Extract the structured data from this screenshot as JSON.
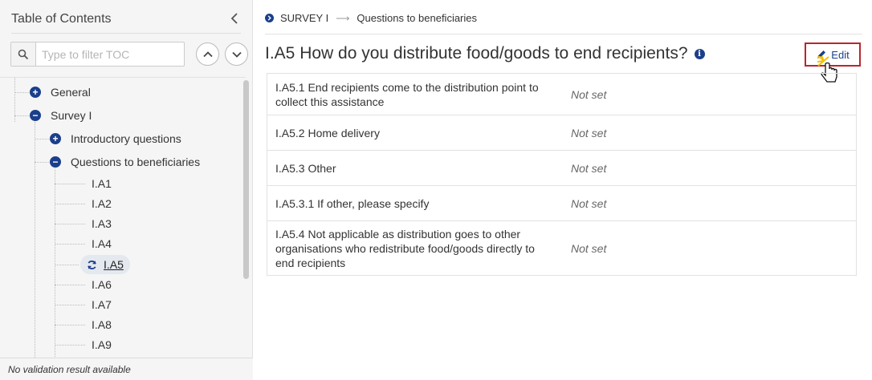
{
  "sidebar": {
    "title": "Table of Contents",
    "filter_placeholder": "Type to filter TOC",
    "tree": {
      "general": "General",
      "survey": "Survey I",
      "introductory": "Introductory questions",
      "beneficiaries": "Questions to beneficiaries",
      "leaves": [
        "I.A1",
        "I.A2",
        "I.A3",
        "I.A4",
        "I.A5",
        "I.A6",
        "I.A7",
        "I.A8",
        "I.A9"
      ]
    },
    "validation": "No validation result available"
  },
  "breadcrumb": {
    "root": "SURVEY I",
    "current": "Questions to beneficiaries"
  },
  "page": {
    "title": "I.A5 How do you distribute food/goods to end recipients?",
    "edit_label": "Edit"
  },
  "table": {
    "rows": [
      {
        "label": "I.A5.1 End recipients come to the distribution point to collect this assistance",
        "value": "Not set"
      },
      {
        "label": "I.A5.2 Home delivery",
        "value": "Not set"
      },
      {
        "label": "I.A5.3 Other",
        "value": "Not set"
      },
      {
        "label": "I.A5.3.1 If other, please specify",
        "value": "Not set"
      },
      {
        "label": "I.A5.4 Not applicable as distribution goes to other organisations who redistribute food/goods directly to end recipients",
        "value": "Not set"
      }
    ]
  },
  "colors": {
    "accent": "#1b3f8b",
    "highlight_border": "#b9262e"
  }
}
